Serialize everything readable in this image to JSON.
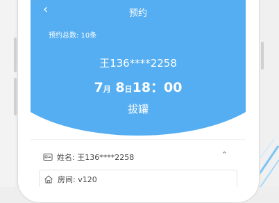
{
  "nav": {
    "back_icon": "chevron-left-icon",
    "title": "预约"
  },
  "summary": {
    "total_label": "预约总数: 10条"
  },
  "booking": {
    "phone": "王136****2258",
    "month": "7",
    "month_unit": "月",
    "day": "8",
    "day_unit": "日",
    "time": "18：00",
    "service": "拔罐"
  },
  "details": {
    "name_label": "姓名: 王136****2258",
    "room_label": "房间: v120",
    "collapse_icon": "chevron-up-icon"
  },
  "colors": {
    "accent": "#55aef2"
  }
}
